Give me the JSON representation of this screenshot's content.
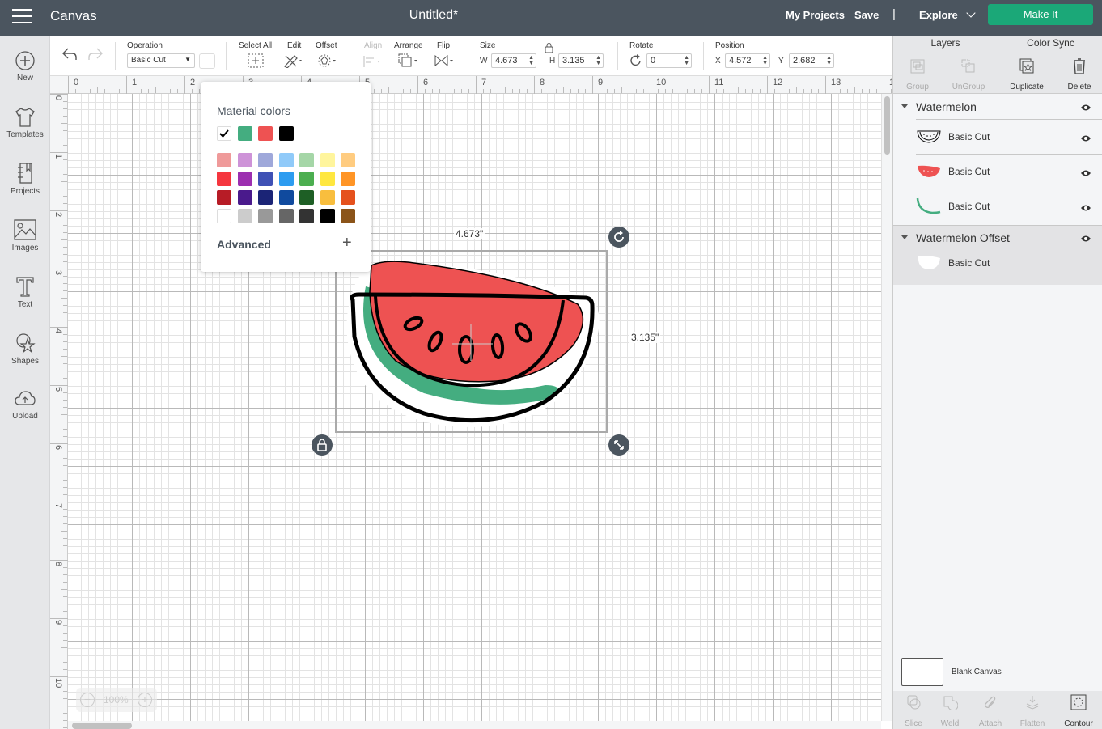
{
  "topbar": {
    "app_title": "Canvas",
    "doc_title": "Untitled*",
    "my_projects": "My Projects",
    "save": "Save",
    "separator": "|",
    "explore": "Explore",
    "make_it": "Make It",
    "make_it_color": "#1ba878"
  },
  "leftbar": {
    "items": [
      {
        "label": "New",
        "icon": "plus-circle-icon"
      },
      {
        "label": "Templates",
        "icon": "shirt-icon"
      },
      {
        "label": "Projects",
        "icon": "notebook-icon"
      },
      {
        "label": "Images",
        "icon": "image-icon"
      },
      {
        "label": "Text",
        "icon": "text-icon"
      },
      {
        "label": "Shapes",
        "icon": "shapes-icon"
      },
      {
        "label": "Upload",
        "icon": "cloud-upload-icon"
      }
    ]
  },
  "toolbar": {
    "operation_label": "Operation",
    "operation_value": "Basic Cut",
    "select_all": "Select All",
    "edit": "Edit",
    "offset": "Offset",
    "align": "Align",
    "arrange": "Arrange",
    "flip": "Flip",
    "size_label": "Size",
    "w_label": "W",
    "w_value": "4.673",
    "h_label": "H",
    "h_value": "3.135",
    "rotate_label": "Rotate",
    "rotate_value": "0",
    "position_label": "Position",
    "x_label": "X",
    "x_value": "4.572",
    "y_label": "Y",
    "y_value": "2.682"
  },
  "rulers": {
    "top": [
      "0",
      "1",
      "2",
      "3",
      "4",
      "5",
      "6",
      "7",
      "8",
      "9",
      "10",
      "11",
      "12",
      "13",
      "1"
    ],
    "left": [
      "0",
      "1",
      "2",
      "3",
      "4",
      "5",
      "6",
      "7",
      "8",
      "9",
      "10"
    ]
  },
  "zoom": {
    "value": "100%",
    "minus": "−",
    "plus": "+"
  },
  "selection": {
    "width_label": "4.673\"",
    "height_label": "3.135\""
  },
  "color_popover": {
    "title": "Material colors",
    "material_colors": [
      "#ffffff",
      "#44ad80",
      "#ee5252",
      "#000000"
    ],
    "selected_index": 0,
    "palette": [
      [
        "#ef9a9a",
        "#ce93d8",
        "#9fa8da",
        "#90caf9",
        "#a5d6a7",
        "#fff59d",
        "#ffcc80"
      ],
      [
        "#f5363f",
        "#9c2fb0",
        "#3f51b5",
        "#2d9cf0",
        "#4cae50",
        "#ffe740",
        "#ff9526"
      ],
      [
        "#b71c26",
        "#4a1a8c",
        "#1b2476",
        "#104a9e",
        "#1e5f25",
        "#f8be3e",
        "#e5511d"
      ],
      [
        "#ffffff",
        "#cccccc",
        "#999999",
        "#666666",
        "#333333",
        "#000000",
        "#8b5419"
      ]
    ],
    "advanced": "Advanced",
    "advanced_plus": "+"
  },
  "rightpanel": {
    "tabs": [
      "Layers",
      "Color Sync"
    ],
    "active_tab": "Layers",
    "actions": [
      {
        "label": "Group",
        "enabled": false
      },
      {
        "label": "UnGroup",
        "enabled": false
      },
      {
        "label": "Duplicate",
        "enabled": true
      },
      {
        "label": "Delete",
        "enabled": true
      }
    ],
    "groups": [
      {
        "name": "Watermelon",
        "layers": [
          {
            "name": "Basic Cut",
            "thumb": "outline"
          },
          {
            "name": "Basic Cut",
            "thumb": "red"
          },
          {
            "name": "Basic Cut",
            "thumb": "green"
          }
        ]
      },
      {
        "name": "Watermelon Offset",
        "layers": [
          {
            "name": "Basic Cut",
            "thumb": "white"
          }
        ]
      }
    ],
    "blank_canvas": "Blank Canvas",
    "tools": [
      {
        "label": "Slice",
        "enabled": false
      },
      {
        "label": "Weld",
        "enabled": false
      },
      {
        "label": "Attach",
        "enabled": false
      },
      {
        "label": "Flatten",
        "enabled": false
      },
      {
        "label": "Contour",
        "enabled": true
      }
    ]
  },
  "artwork": {
    "red": "#ee5252",
    "green": "#44ad80",
    "outline": "#000000"
  }
}
